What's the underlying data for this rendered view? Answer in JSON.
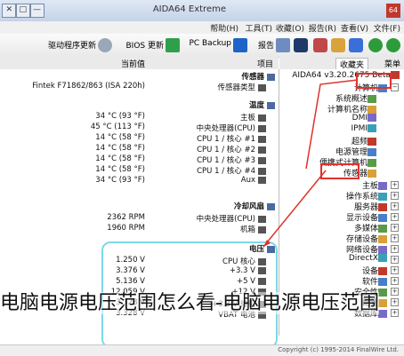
{
  "window": {
    "title": "AIDA64 Extreme",
    "app_icon": "64",
    "controls": [
      "—",
      "□",
      "✕"
    ]
  },
  "menu": [
    "文件(F)",
    "查看(V)",
    "报告(R)",
    "收藏(O)",
    "工具(T)",
    "帮助(H)"
  ],
  "toolbar": {
    "report": "报告",
    "pc_backup": "PC Backup",
    "bios_update": "BIOS 更新",
    "driver_update": "驱动程序更新"
  },
  "left_pane": {
    "tabs": [
      "菜单",
      "收藏夹"
    ],
    "items": [
      {
        "label": "AIDA64 v3.20.2675 Beta",
        "level": 0,
        "icon": "aida-icon"
      },
      {
        "label": "计算机",
        "level": 1,
        "icon": "computer-icon",
        "expander": "−"
      },
      {
        "label": "系统概述",
        "level": 2,
        "icon": "summary-icon"
      },
      {
        "label": "计算机名称",
        "level": 2,
        "icon": "name-icon"
      },
      {
        "label": "DMI",
        "level": 2,
        "icon": "dmi-icon"
      },
      {
        "label": "IPMI",
        "level": 2,
        "icon": "ipmi-icon"
      },
      {
        "label": "超频",
        "level": 2,
        "icon": "overclock-icon"
      },
      {
        "label": "电源管理",
        "level": 2,
        "icon": "power-icon"
      },
      {
        "label": "便携式计算机",
        "level": 2,
        "icon": "laptop-icon"
      },
      {
        "label": "传感器",
        "level": 2,
        "icon": "sensor-icon"
      },
      {
        "label": "主板",
        "level": 1,
        "icon": "motherboard-icon",
        "expander": "+"
      },
      {
        "label": "操作系统",
        "level": 1,
        "icon": "os-icon",
        "expander": "+"
      },
      {
        "label": "服务器",
        "level": 1,
        "icon": "server-icon",
        "expander": "+"
      },
      {
        "label": "显示设备",
        "level": 1,
        "icon": "display-icon",
        "expander": "+"
      },
      {
        "label": "多媒体",
        "level": 1,
        "icon": "multimedia-icon",
        "expander": "+"
      },
      {
        "label": "存储设备",
        "level": 1,
        "icon": "storage-icon",
        "expander": "+"
      },
      {
        "label": "网络设备",
        "level": 1,
        "icon": "network-icon",
        "expander": "+"
      },
      {
        "label": "DirectX",
        "level": 1,
        "icon": "directx-icon",
        "expander": "+"
      },
      {
        "label": "设备",
        "level": 1,
        "icon": "device-icon",
        "expander": "+"
      },
      {
        "label": "软件",
        "level": 1,
        "icon": "software-icon",
        "expander": "+"
      },
      {
        "label": "安全性",
        "level": 1,
        "icon": "security-icon",
        "expander": "+"
      },
      {
        "label": "配置",
        "level": 1,
        "icon": "config-icon",
        "expander": "+"
      },
      {
        "label": "数据库",
        "level": 1,
        "icon": "database-icon",
        "expander": "+"
      }
    ]
  },
  "right_pane": {
    "columns": [
      "项目",
      "当前值"
    ],
    "rows": [
      {
        "item": "传感器",
        "value": "",
        "type": "section"
      },
      {
        "item": "传感器类型",
        "value": "Fintek F71862/863 (ISA 220h)",
        "type": "row"
      },
      {
        "item": "温度",
        "value": "",
        "type": "section"
      },
      {
        "item": "主板",
        "value": "34 °C (93 °F)",
        "type": "row"
      },
      {
        "item": "中央处理器(CPU)",
        "value": "45 °C (113 °F)",
        "type": "row"
      },
      {
        "item": "CPU 1 / 核心 #1",
        "value": "14 °C (58 °F)",
        "type": "row"
      },
      {
        "item": "CPU 1 / 核心 #2",
        "value": "14 °C (58 °F)",
        "type": "row"
      },
      {
        "item": "CPU 1 / 核心 #3",
        "value": "14 °C (58 °F)",
        "type": "row"
      },
      {
        "item": "CPU 1 / 核心 #4",
        "value": "14 °C (58 °F)",
        "type": "row"
      },
      {
        "item": "Aux",
        "value": "34 °C (93 °F)",
        "type": "row"
      },
      {
        "item": "冷却风扇",
        "value": "",
        "type": "section"
      },
      {
        "item": "中央处理器(CPU)",
        "value": "2362 RPM",
        "type": "row"
      },
      {
        "item": "机箱",
        "value": "1960 RPM",
        "type": "row"
      },
      {
        "item": "电压",
        "value": "",
        "type": "section"
      },
      {
        "item": "CPU 核心",
        "value": "1.250 V",
        "type": "row"
      },
      {
        "item": "+3.3 V",
        "value": "3.376 V",
        "type": "row"
      },
      {
        "item": "+5 V",
        "value": "5.136 V",
        "type": "row"
      },
      {
        "item": "+12 V",
        "value": "12.059 V",
        "type": "row"
      },
      {
        "item": "+3.3 V 待机",
        "value": "3.328 V",
        "type": "row"
      },
      {
        "item": "VBAT 电池",
        "value": "3.328 V",
        "type": "row"
      }
    ]
  },
  "caption": "电脑电源电压范围怎么看-电脑电源电压范围",
  "status": "Copyright (c) 1995-2014 FinalWire Ltd.",
  "colors": {
    "highlight_red": "#e0312b",
    "highlight_cyan": "#7fd8e8"
  }
}
